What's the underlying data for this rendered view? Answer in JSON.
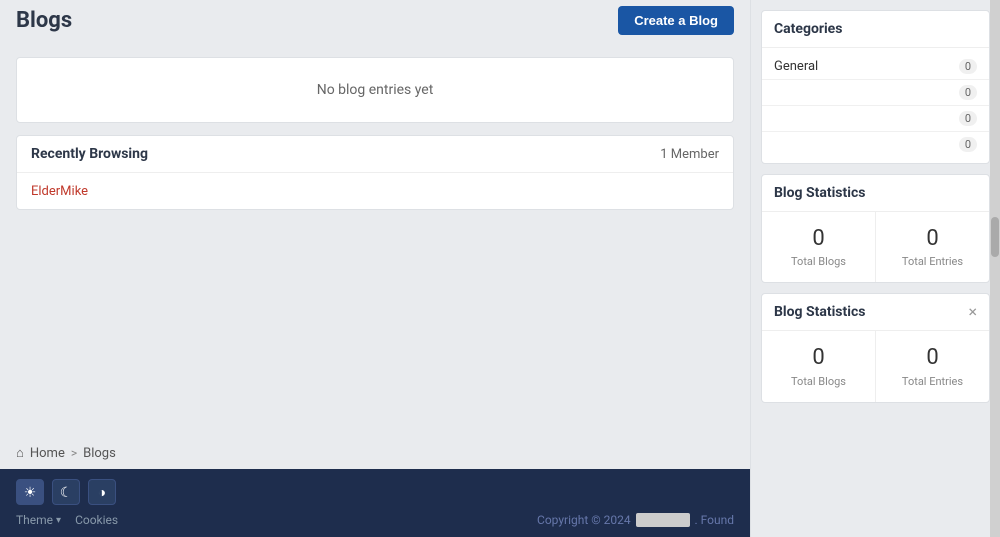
{
  "header": {
    "title": "Blogs",
    "create_button_label": "Create a Blog"
  },
  "main": {
    "no_entries_text": "No blog entries yet",
    "recently_browsing": {
      "title": "Recently Browsing",
      "member_count": "1 Member",
      "user": "ElderMike"
    }
  },
  "breadcrumb": {
    "home": "Home",
    "separator": ">",
    "current": "Blogs"
  },
  "footer": {
    "theme_label": "Theme",
    "cookies_label": "Cookies",
    "copyright": "Copyright © 2024",
    "founded_text": ". Found"
  },
  "sidebar": {
    "categories": {
      "title": "Categories",
      "items": [
        {
          "name": "General",
          "count": "0"
        },
        {
          "name": "",
          "count": "0"
        },
        {
          "name": "",
          "count": "0"
        },
        {
          "name": "",
          "count": "0"
        }
      ]
    },
    "blog_statistics": {
      "title": "Blog Statistics",
      "total_blogs_label": "Total Blogs",
      "total_entries_label": "Total Entries",
      "total_blogs_value": "0",
      "total_entries_value": "0"
    },
    "blog_statistics_floating": {
      "title": "Blog Statistics",
      "total_blogs_label": "Total Blogs",
      "total_entries_label": "Total Entries",
      "total_blogs_value": "0",
      "total_entries_value": "0"
    }
  }
}
